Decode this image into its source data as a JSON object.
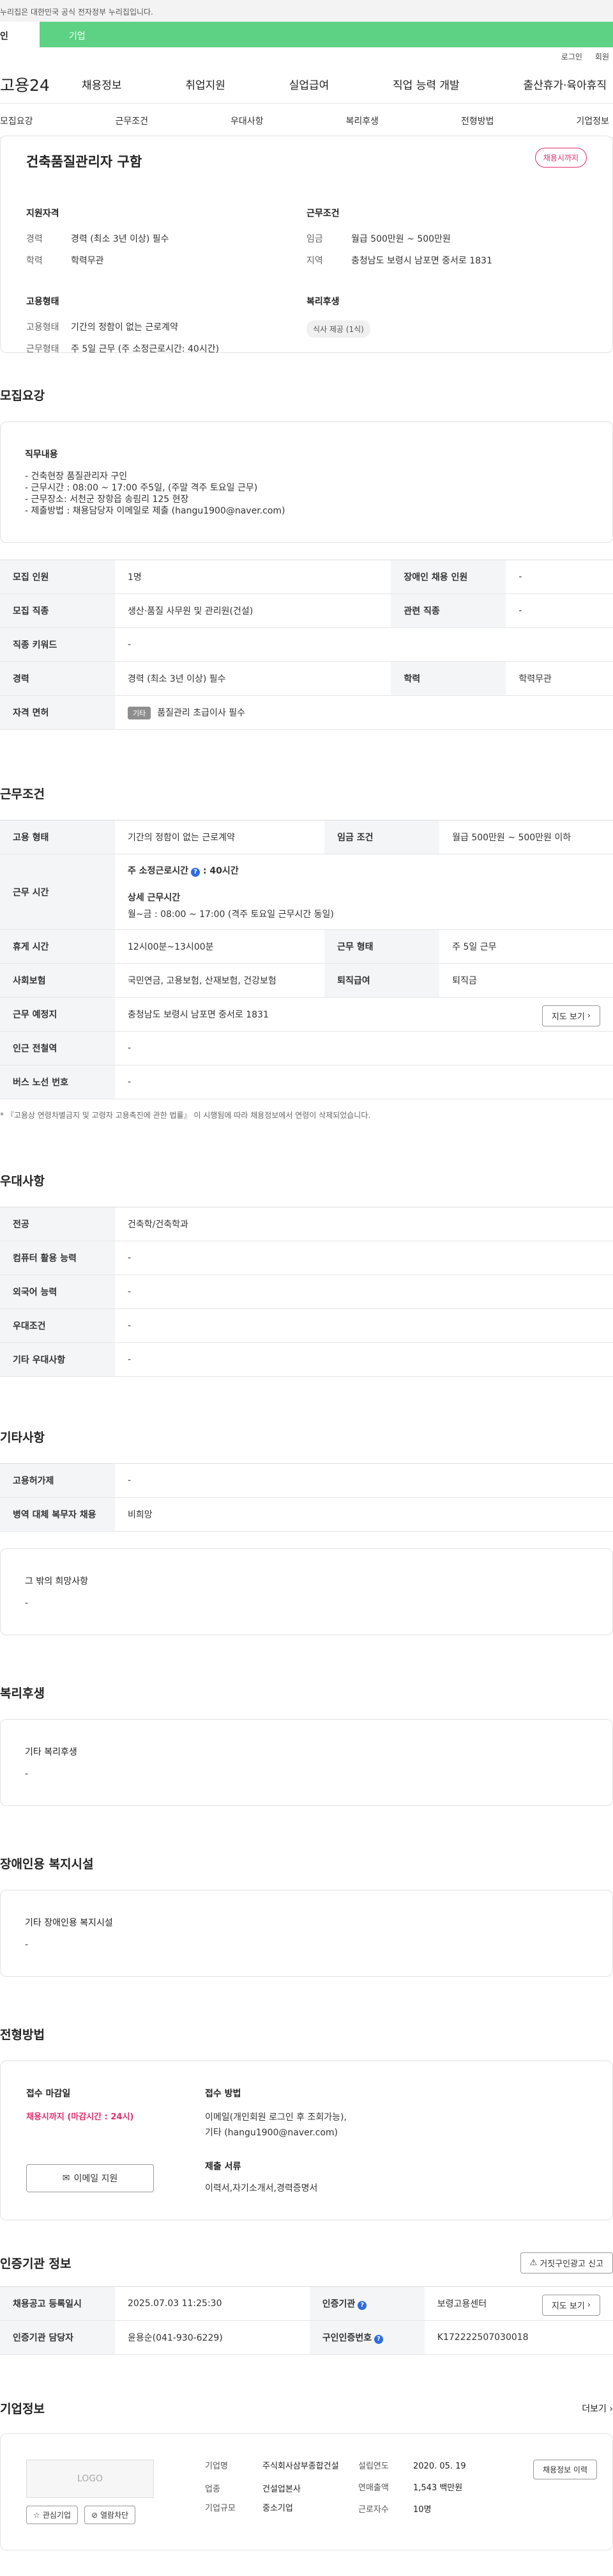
{
  "gov_notice": "누리집은 대한민국 공식 전자정부 누리집입니다.",
  "top_tabs": {
    "person": "인",
    "company": "기업"
  },
  "util": {
    "login": "로그인",
    "join": "회원"
  },
  "gnb": {
    "logo": "고용24",
    "items": [
      "채용정보",
      "취업지원",
      "실업급여",
      "직업 능력 개발",
      "출산휴가·육아휴직"
    ]
  },
  "anchor_nav": [
    "모집요강",
    "근무조건",
    "우대사항",
    "복리후생",
    "전형방법",
    "기업정보"
  ],
  "summary": {
    "title": "건축품질관리자 구함",
    "status": "채용시까지",
    "qual_title": "지원자격",
    "qual_rows": [
      {
        "k": "경력",
        "v": "경력 (최소 3년 이상) 필수"
      },
      {
        "k": "학력",
        "v": "학력무관"
      }
    ],
    "emp_title": "고용형태",
    "emp_rows": [
      {
        "k": "고용형태",
        "v": "기간의 정함이 없는 근로계약"
      },
      {
        "k": "근무형태",
        "v": "주 5일 근무 (주 소정근로시간: 40시간)"
      }
    ],
    "work_title": "근무조건",
    "work_rows": [
      {
        "k": "임금",
        "v": "월급 500만원 ~ 500만원"
      },
      {
        "k": "지역",
        "v": "충청남도 보령시 남포면 중서로 1831"
      }
    ],
    "welfare_title": "복리후생",
    "welfare_chip": "식사 제공 (1식)"
  },
  "recruit": {
    "section_title": "모집요강",
    "duty_title": "직무내용",
    "duty_lines": [
      "- 건축현장 품질관리자 구인",
      "- 근무시간 : 08:00 ~ 17:00 주5일, (주말 격주 토요일 근무)",
      "- 근무장소: 서천군 장항읍 송림리 125 현장",
      "- 제출방법 : 채용담당자 이메일로 제출 (hangu1900@naver.com)"
    ],
    "rows": [
      {
        "k1": "모집 인원",
        "v1": "1명",
        "k2": "장애인 채용 인원",
        "v2": "-"
      },
      {
        "k1": "모집 직종",
        "v1": "생산·품질 사무원 및 관리원(건설)",
        "k2": "관련 직종",
        "v2": "-"
      }
    ],
    "keyword_k": "직종 키워드",
    "keyword_v": "-",
    "career_k": "경력",
    "career_v": "경력 (최소 3년 이상) 필수",
    "edu_k": "학력",
    "edu_v": "학력무관",
    "license_k": "자격 면허",
    "license_chip": "기타",
    "license_v": "품질관리 초급이사 필수"
  },
  "condition": {
    "section_title": "근무조건",
    "type_k": "고용 형태",
    "type_v": "기간의 정함이 없는 근로계약",
    "wage_k": "임금 조건",
    "wage_v": "월급 500만원 ~ 500만원 이하",
    "hours_k": "근무 시간",
    "hours_main": "주 소정근로시간",
    "hours_main_val": ": 40시간",
    "hours_detail_title": "상세 근무시간",
    "hours_detail": "월~금 : 08:00 ~ 17:00 (격주 토요일 근무시간 동일)",
    "break_k": "휴게 시간",
    "break_v": "12시00분~13시00분",
    "form_k": "근무 형태",
    "form_v": "주 5일 근무",
    "insure_k": "사회보험",
    "insure_v": "국민연금, 고용보험, 산재보험, 건강보험",
    "retire_k": "퇴직급여",
    "retire_v": "퇴직금",
    "place_k": "근무 예정지",
    "place_v": "충청남도 보령시 남포면 중서로 1831",
    "map_btn": "지도 보기",
    "subway_k": "인근 전철역",
    "subway_v": "-",
    "bus_k": "버스 노선 번호",
    "bus_v": "-",
    "note": "* 『고용상 연령차별금지 및 고령자 고용촉진에 관한 법률』 이 시행됨에 따라 채용정보에서 연령이 삭제되었습니다."
  },
  "pref": {
    "section_title": "우대사항",
    "rows": [
      {
        "k": "전공",
        "v": "건축학/건축학과"
      },
      {
        "k": "컴퓨터 활용 능력",
        "v": "-"
      },
      {
        "k": "외국어 능력",
        "v": "-"
      },
      {
        "k": "우대조건",
        "v": "-"
      },
      {
        "k": "기타 우대사항",
        "v": "-"
      }
    ]
  },
  "etc": {
    "section_title": "기타사항",
    "rows": [
      {
        "k": "고용허가제",
        "v": "-"
      },
      {
        "k": "병역 대체 복무자 채용",
        "v": "비희망"
      }
    ],
    "other_title": "그 밖의 희망사항",
    "other_v": "-"
  },
  "welfare": {
    "section_title": "복리후생",
    "box_title": "기타 복리후생",
    "box_v": "-"
  },
  "disabled": {
    "section_title": "장애인용 복지시설",
    "box_title": "기타 장애인용 복지시설",
    "box_v": "-"
  },
  "method": {
    "section_title": "전형방법",
    "deadline_title": "접수 마감일",
    "deadline_v": "채용시까지 (마감시간 : 24시)",
    "apply_btn": "이메일 지원",
    "recv_title": "접수 방법",
    "recv_lines": [
      "이메일(개인회원 로그인 후 조회가능),",
      "기타 (hangu1900@naver.com)"
    ],
    "docs_title": "제출 서류",
    "docs_v": "이력서,자기소개서,경력증명서"
  },
  "cert": {
    "section_title": "인증기관 정보",
    "report_btn": "거짓구인광고 신고",
    "reg_k": "채용공고 등록일시",
    "reg_v": "2025.07.03 11:25:30",
    "org_k": "인증기관",
    "org_v": "보령고용센터",
    "map_btn": "지도 보기",
    "mgr_k": "인증기관 담당자",
    "mgr_v": "윤용순(041-930-6229)",
    "num_k": "구인인증번호",
    "num_v": "K172222507030018"
  },
  "company": {
    "section_title": "기업정보",
    "more": "더보기",
    "logo": "LOGO",
    "fav_btn": "관심기업",
    "block_btn": "열람차단",
    "name_k": "기업명",
    "name_v": "주식회사삼부종합건설",
    "ind_k": "업종",
    "ind_v": "건설업본사",
    "size_k": "기업규모",
    "size_v": "중소기업",
    "year_k": "설립연도",
    "year_v": "2020. 05. 19",
    "sales_k": "연매출액",
    "sales_v": "1,543 백만원",
    "staff_k": "근로자수",
    "staff_v": "10명",
    "history_btn": "채용정보 이력"
  }
}
